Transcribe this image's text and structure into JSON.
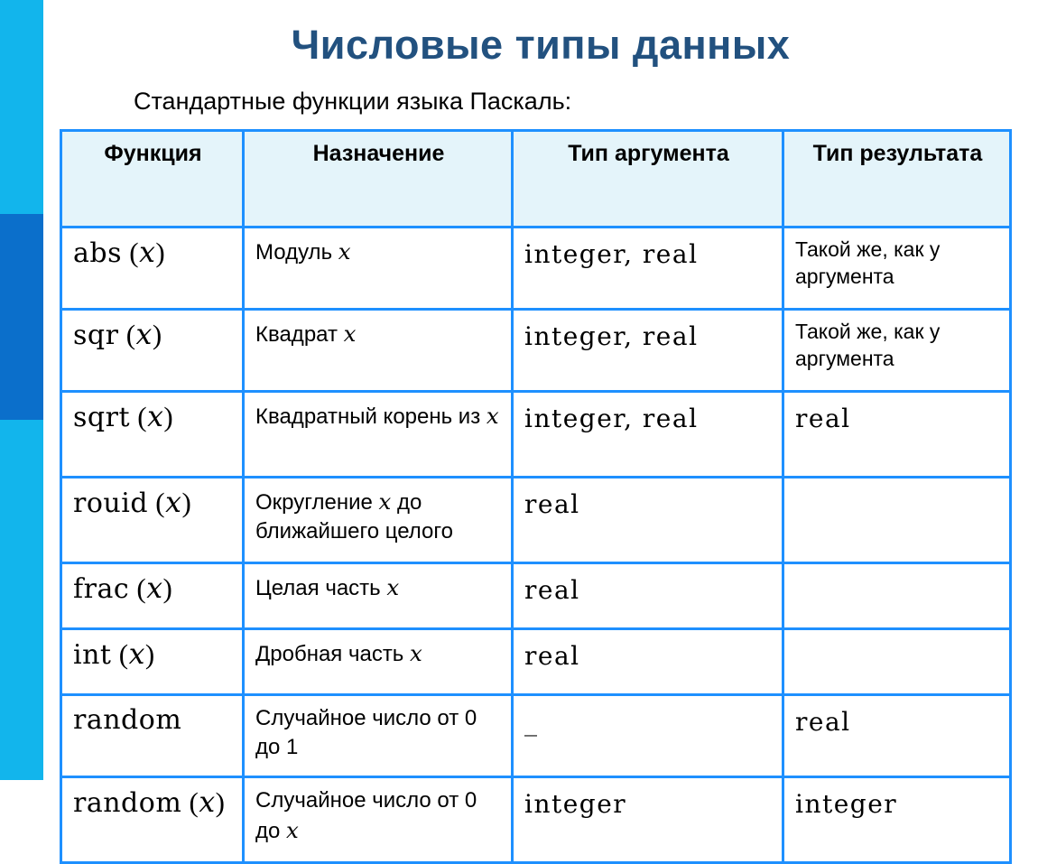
{
  "slide": {
    "title": "Числовые типы данных",
    "subtitle": "Стандартные функции языка Паскаль:",
    "title_color": "#22517F",
    "accent_cyan": "#12B5EC",
    "accent_blue": "#0B6FCB",
    "table_border_color": "#1E90FF",
    "header_fill": "#E4F4FA"
  },
  "table": {
    "headers": [
      "Функция",
      "Назначение",
      "Тип аргумента",
      "Тип результата"
    ],
    "rows": [
      {
        "fn": "abs",
        "fn_arg": "(x)",
        "desc_pre": "Модуль ",
        "desc_var": "x",
        "desc_post": "",
        "arg_type": "integer, real",
        "result_type": "Такой же, как у аргумента",
        "result_is_prose": true
      },
      {
        "fn": "sqr",
        "fn_arg": "(x)",
        "desc_pre": "Квадрат ",
        "desc_var": "x",
        "desc_post": "",
        "arg_type": "integer, real",
        "result_type": "Такой же, как у аргумента",
        "result_is_prose": true
      },
      {
        "fn": "sqrt",
        "fn_arg": "(x)",
        "desc_pre": "Квадратный корень из ",
        "desc_var": "x",
        "desc_post": "",
        "arg_type": "integer, real",
        "result_type": "real",
        "result_is_prose": false
      },
      {
        "fn": "rouid",
        "fn_arg": "(x)",
        "desc_pre": "Округление ",
        "desc_var": "x",
        "desc_post": " до ближайшего целого",
        "arg_type": "real",
        "result_type": "",
        "result_is_prose": false
      },
      {
        "fn": "frac",
        "fn_arg": "(x)",
        "desc_pre": "Целая часть ",
        "desc_var": "x",
        "desc_post": "",
        "arg_type": "real",
        "result_type": "",
        "result_is_prose": false
      },
      {
        "fn": "int",
        "fn_arg": "(x)",
        "desc_pre": "Дробная часть ",
        "desc_var": "x",
        "desc_post": "",
        "arg_type": "real",
        "result_type": "",
        "result_is_prose": false
      },
      {
        "fn": "random",
        "fn_arg": "",
        "desc_pre": "Случайное число от 0 до 1",
        "desc_var": "",
        "desc_post": "",
        "arg_type": "_",
        "result_type": "real",
        "result_is_prose": false
      },
      {
        "fn": "random",
        "fn_arg": "(x)",
        "desc_pre": "Случайное число от 0 до ",
        "desc_var": "x",
        "desc_post": "",
        "arg_type": "integer",
        "result_type": "integer",
        "result_is_prose": false
      }
    ]
  }
}
